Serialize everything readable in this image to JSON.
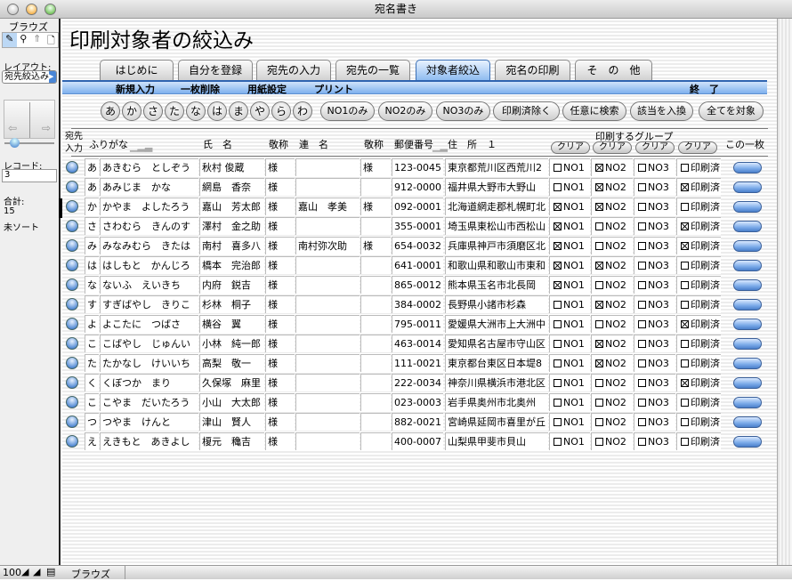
{
  "window": {
    "title": "宛名書き"
  },
  "sidebar": {
    "mode": "ブラウズ",
    "layout_label": "レイアウト:",
    "layout_value": "宛先絞込み",
    "record_label": "レコード:",
    "record_value": "3",
    "total_label": "合計:",
    "total_value": "15",
    "sort_status": "未ソート"
  },
  "bottom": {
    "zoom": "100",
    "mode": "ブラウズ"
  },
  "page_title": "印刷対象者の絞込み",
  "tabs": [
    {
      "label": "はじめに"
    },
    {
      "label": "自分を登録"
    },
    {
      "label": "宛先の入力"
    },
    {
      "label": "宛先の一覧"
    },
    {
      "label": "対象者絞込",
      "active": true
    },
    {
      "label": "宛名の印刷"
    },
    {
      "label": "そ　の　他"
    }
  ],
  "menu": {
    "new": "新規入力",
    "delete": "一枚削除",
    "page_setup": "用紙設定",
    "print": "プリント",
    "quit": "終　了"
  },
  "kana_buttons": [
    "あ",
    "か",
    "さ",
    "た",
    "な",
    "は",
    "ま",
    "や",
    "ら",
    "わ"
  ],
  "filter_buttons": [
    "NO1のみ",
    "NO2のみ",
    "NO3のみ",
    "印刷済除く",
    "任意に検索",
    "該当を入換",
    "全てを対象"
  ],
  "headers": {
    "entry": "宛先入力",
    "entry1": "宛先",
    "entry2": "入力",
    "furigana": "ふりがな",
    "name": "氏　名",
    "honorific": "敬称",
    "joint": "連　名",
    "honorific2": "敬称",
    "zip": "郵便番号",
    "address": "住　所　１",
    "group": "印刷するグループ",
    "clear": "クリア",
    "single": "この一枚"
  },
  "check_labels": [
    "NO1",
    "NO2",
    "NO3",
    "印刷済"
  ],
  "rows": [
    {
      "initial": "あ",
      "furigana": "あきむら　としぞう",
      "name": "秋村 俊蔵",
      "honorific": "様",
      "joint": "",
      "honorific2": "様",
      "zip": "123-0045",
      "address": "東京都荒川区西荒川2",
      "checks": [
        false,
        true,
        false,
        false
      ]
    },
    {
      "initial": "あ",
      "furigana": "あみじま　かな",
      "name": "網島　香奈",
      "honorific": "様",
      "joint": "",
      "honorific2": "",
      "zip": "912-0000",
      "address": "福井県大野市大野山",
      "checks": [
        false,
        true,
        false,
        true
      ]
    },
    {
      "initial": "か",
      "furigana": "かやま　よしたろう",
      "name": "嘉山　芳太郎",
      "honorific": "様",
      "joint": "嘉山　孝美",
      "honorific2": "様",
      "zip": "092-0001",
      "address": "北海道網走郡札幌町北",
      "checks": [
        true,
        true,
        false,
        false
      ]
    },
    {
      "initial": "さ",
      "furigana": "さわむら　きんのす",
      "name": "澤村　金之助",
      "honorific": "様",
      "joint": "",
      "honorific2": "",
      "zip": "355-0001",
      "address": "埼玉県東松山市西松山",
      "checks": [
        true,
        false,
        false,
        true
      ]
    },
    {
      "initial": "み",
      "furigana": "みなみむら　きたは",
      "name": "南村　喜多八",
      "honorific": "様",
      "joint": "南村弥次助",
      "honorific2": "様",
      "zip": "654-0032",
      "address": "兵庫県神戸市須磨区北",
      "checks": [
        true,
        false,
        false,
        true
      ]
    },
    {
      "initial": "は",
      "furigana": "はしもと　かんじろ",
      "name": "橋本　完治郎",
      "honorific": "様",
      "joint": "",
      "honorific2": "",
      "zip": "641-0001",
      "address": "和歌山県和歌山市東和",
      "checks": [
        true,
        true,
        false,
        false
      ]
    },
    {
      "initial": "な",
      "furigana": "ないふ　えいきち",
      "name": "内府　鋭吉",
      "honorific": "様",
      "joint": "",
      "honorific2": "",
      "zip": "865-0012",
      "address": "熊本県玉名市北長岡",
      "checks": [
        true,
        false,
        false,
        false
      ]
    },
    {
      "initial": "す",
      "furigana": "すぎばやし　きりこ",
      "name": "杉林　桐子",
      "honorific": "様",
      "joint": "",
      "honorific2": "",
      "zip": "384-0002",
      "address": "長野県小諸市杉森",
      "checks": [
        false,
        true,
        false,
        false
      ]
    },
    {
      "initial": "よ",
      "furigana": "よこたに　つばさ",
      "name": "横谷　翼",
      "honorific": "様",
      "joint": "",
      "honorific2": "",
      "zip": "795-0011",
      "address": "愛媛県大洲市上大洲中",
      "checks": [
        false,
        false,
        false,
        true
      ]
    },
    {
      "initial": "こ",
      "furigana": "こばやし　じゅんい",
      "name": "小林　純一郎",
      "honorific": "様",
      "joint": "",
      "honorific2": "",
      "zip": "463-0014",
      "address": "愛知県名古屋市守山区",
      "checks": [
        false,
        true,
        false,
        false
      ]
    },
    {
      "initial": "た",
      "furigana": "たかなし　けいいち",
      "name": "高梨　敬一",
      "honorific": "様",
      "joint": "",
      "honorific2": "",
      "zip": "111-0021",
      "address": "東京都台東区日本堤8",
      "checks": [
        false,
        true,
        false,
        false
      ]
    },
    {
      "initial": "く",
      "furigana": "くぼつか　まり",
      "name": "久保塚　麻里",
      "honorific": "様",
      "joint": "",
      "honorific2": "",
      "zip": "222-0034",
      "address": "神奈川県横浜市港北区",
      "checks": [
        false,
        false,
        false,
        true
      ]
    },
    {
      "initial": "こ",
      "furigana": "こやま　だいたろう",
      "name": "小山　大太郎",
      "honorific": "様",
      "joint": "",
      "honorific2": "",
      "zip": "023-0003",
      "address": "岩手県奥州市北奥州",
      "checks": [
        false,
        false,
        false,
        false
      ]
    },
    {
      "initial": "つ",
      "furigana": "つやま　けんと",
      "name": "津山　賢人",
      "honorific": "様",
      "joint": "",
      "honorific2": "",
      "zip": "882-0021",
      "address": "宮崎県延岡市喜里が丘",
      "checks": [
        false,
        false,
        false,
        false
      ]
    },
    {
      "initial": "え",
      "furigana": "えきもと　あきよし",
      "name": "榎元　穐吉",
      "honorific": "様",
      "joint": "",
      "honorific2": "",
      "zip": "400-0007",
      "address": "山梨県甲斐市貝山",
      "checks": [
        false,
        false,
        false,
        false
      ]
    }
  ]
}
